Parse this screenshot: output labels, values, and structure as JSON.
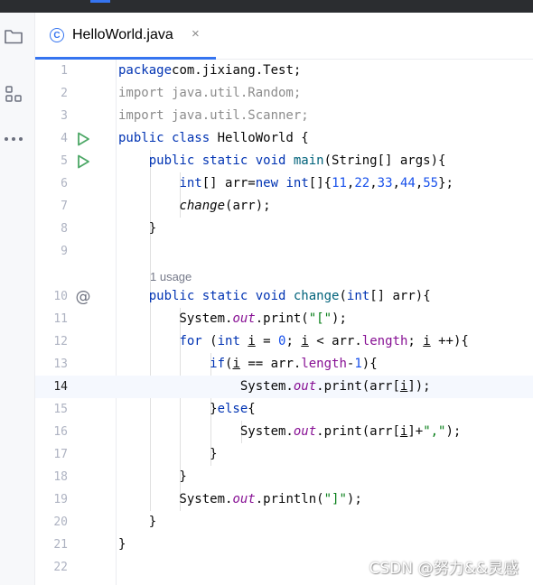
{
  "tab": {
    "file_name": "HelloWorld.java",
    "icon_letter": "C",
    "close_glyph": "×"
  },
  "sidebar": {
    "items": [
      "project-folder",
      "structure",
      "more"
    ]
  },
  "editor": {
    "current_line": 14,
    "usage_hint": "1 usage",
    "line_numbers": [
      "1",
      "2",
      "3",
      "4",
      "5",
      "6",
      "7",
      "8",
      "9",
      "10",
      "11",
      "12",
      "13",
      "14",
      "15",
      "16",
      "17",
      "18",
      "19",
      "20",
      "21",
      "22"
    ],
    "lines": [
      [
        [
          "kw",
          "package"
        ],
        [
          "",
          "com.jixiang.Test;"
        ]
      ],
      [
        [
          "imp",
          "import java.util.Random;"
        ]
      ],
      [
        [
          "imp",
          "import java.util.Scanner;"
        ]
      ],
      [
        [
          "kw",
          "public class "
        ],
        [
          "",
          "HelloWorld {"
        ]
      ],
      [
        [
          "",
          "    "
        ],
        [
          "kw",
          "public static void "
        ],
        [
          "fn",
          "main"
        ],
        [
          "",
          "(String[] args){"
        ]
      ],
      [
        [
          "",
          "        "
        ],
        [
          "kw",
          "int"
        ],
        [
          "",
          "[] arr="
        ],
        [
          "kw",
          "new int"
        ],
        [
          "",
          "[]{"
        ],
        [
          "num",
          "11"
        ],
        [
          "",
          ","
        ],
        [
          "num",
          "22"
        ],
        [
          "",
          ","
        ],
        [
          "num",
          "33"
        ],
        [
          "",
          ","
        ],
        [
          "num",
          "44"
        ],
        [
          "",
          ","
        ],
        [
          "num",
          "55"
        ],
        [
          "",
          "};"
        ]
      ],
      [
        [
          "",
          "        "
        ],
        [
          "it",
          "change"
        ],
        [
          "",
          "(arr);"
        ]
      ],
      [
        [
          "",
          "    }"
        ]
      ],
      [],
      [
        [
          "",
          "    "
        ],
        [
          "kw",
          "public static void "
        ],
        [
          "fn",
          "change"
        ],
        [
          "",
          "("
        ],
        [
          "kw",
          "int"
        ],
        [
          "",
          "[] arr){"
        ]
      ],
      [
        [
          "",
          "        System."
        ],
        [
          "sfld",
          "out"
        ],
        [
          "",
          ".print("
        ],
        [
          "str",
          "\"[\""
        ],
        [
          "",
          ");"
        ]
      ],
      [
        [
          "",
          "        "
        ],
        [
          "kw",
          "for "
        ],
        [
          "",
          "("
        ],
        [
          "kw",
          "int "
        ],
        [
          "u",
          "i"
        ],
        [
          "",
          " = "
        ],
        [
          "num",
          "0"
        ],
        [
          "",
          "; "
        ],
        [
          "u",
          "i"
        ],
        [
          "",
          " < arr."
        ],
        [
          "fld",
          "length"
        ],
        [
          "",
          "; "
        ],
        [
          "u",
          "i"
        ],
        [
          "",
          " ++){"
        ]
      ],
      [
        [
          "",
          "            "
        ],
        [
          "kw",
          "if"
        ],
        [
          "",
          "("
        ],
        [
          "u",
          "i"
        ],
        [
          "",
          " == arr."
        ],
        [
          "fld",
          "length"
        ],
        [
          "",
          "-"
        ],
        [
          "num",
          "1"
        ],
        [
          "",
          "){"
        ]
      ],
      [
        [
          "",
          "                System."
        ],
        [
          "sfld",
          "out"
        ],
        [
          "",
          ".print(arr["
        ],
        [
          "u",
          "i"
        ],
        [
          "",
          "]);"
        ]
      ],
      [
        [
          "",
          "            }"
        ],
        [
          "kw",
          "else"
        ],
        [
          "",
          "{"
        ]
      ],
      [
        [
          "",
          "                System."
        ],
        [
          "sfld",
          "out"
        ],
        [
          "",
          ".print(arr["
        ],
        [
          "u",
          "i"
        ],
        [
          "",
          "]+"
        ],
        [
          "str",
          "\",\""
        ],
        [
          "",
          ");"
        ]
      ],
      [
        [
          "",
          "            }"
        ]
      ],
      [
        [
          "",
          "        }"
        ]
      ],
      [
        [
          "",
          "        System."
        ],
        [
          "sfld",
          "out"
        ],
        [
          "",
          ".println("
        ],
        [
          "str",
          "\"]\""
        ],
        [
          "",
          ");"
        ]
      ],
      [
        [
          "",
          "    }"
        ]
      ],
      [
        [
          "",
          "}"
        ]
      ],
      []
    ],
    "gutter_icons": {
      "4": "run-icon",
      "5": "run-icon",
      "10": "override-icon"
    }
  },
  "watermark": "CSDN @努力&&灵感",
  "colors": {
    "keyword": "#0033b3",
    "method": "#00627a",
    "number": "#1750eb",
    "string": "#067d17",
    "field": "#871094",
    "import": "#8c8c8c",
    "accent": "#3574f0",
    "run": "#4ca766"
  }
}
